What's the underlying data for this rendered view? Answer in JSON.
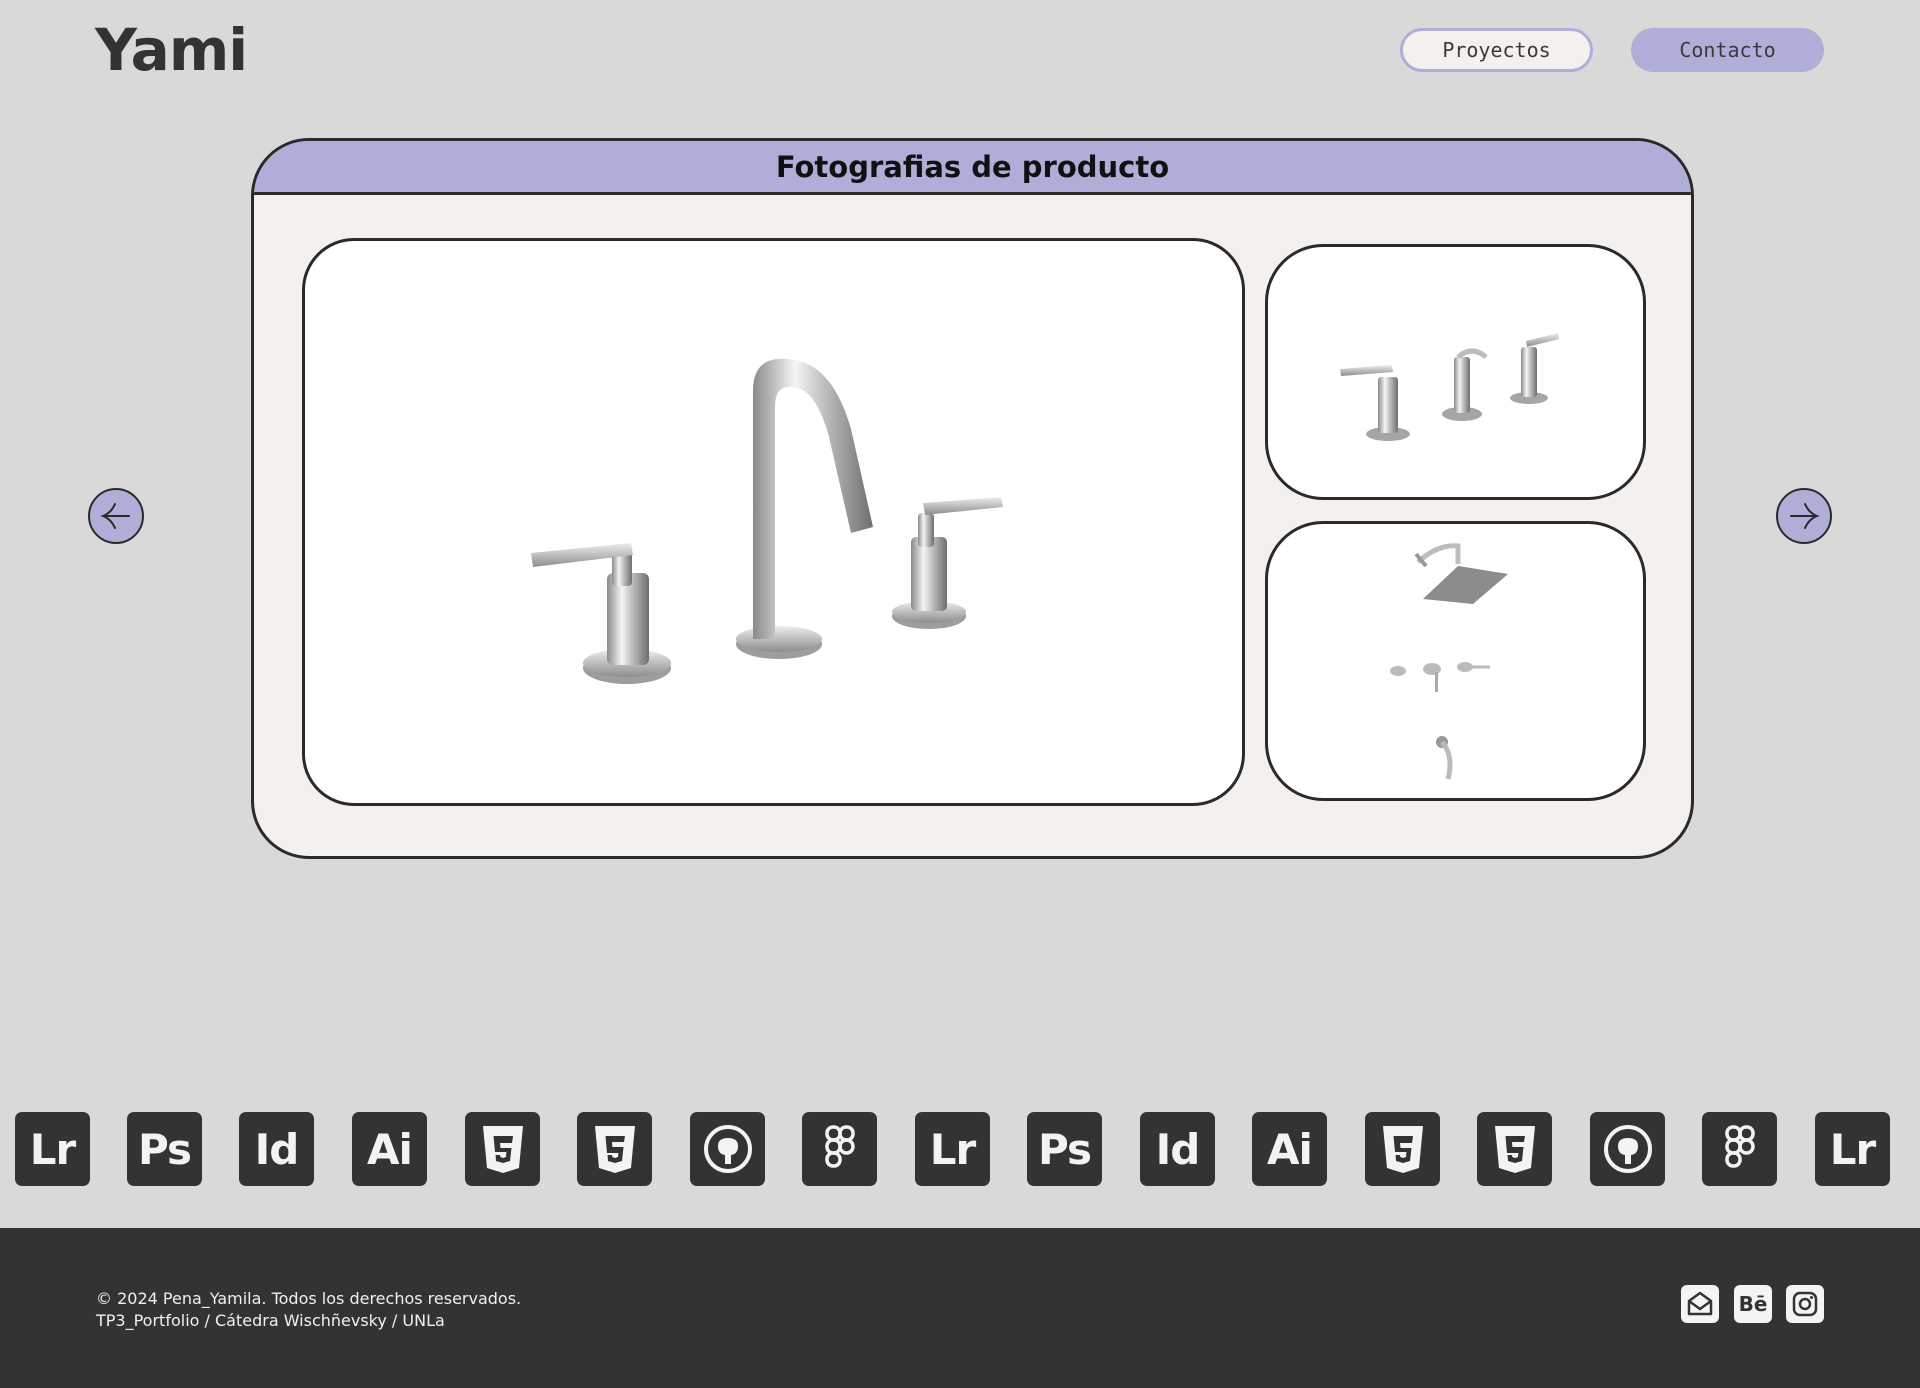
{
  "header": {
    "logo": "Yami",
    "nav": [
      {
        "label": "Proyectos"
      },
      {
        "label": "Contacto"
      }
    ]
  },
  "gallery": {
    "title": "Fotografias de producto",
    "main_image": "faucet-set-three-piece",
    "thumbnails": [
      "faucet-set-three-piece-small",
      "shower-set"
    ]
  },
  "tools": [
    "Lr",
    "Ps",
    "Id",
    "Ai",
    "html5-icon",
    "css3-icon",
    "github-icon",
    "figma-icon",
    "Lr",
    "Ps",
    "Id",
    "Ai",
    "html5-icon",
    "css3-icon",
    "github-icon",
    "figma-icon",
    "Lr"
  ],
  "footer": {
    "line1": "© 2024 Pena_Yamila. Todos los derechos reservados.",
    "line2": "TP3_Portfolio / Cátedra Wischñevsky / UNLa",
    "social": [
      {
        "icon": "email-icon"
      },
      {
        "label": "Bē",
        "icon": "behance-icon"
      },
      {
        "icon": "instagram-icon"
      }
    ]
  },
  "colors": {
    "background": "#d9d9d9",
    "accent": "#aeaed9",
    "card": "#f3f0ee",
    "dark": "#333333"
  }
}
